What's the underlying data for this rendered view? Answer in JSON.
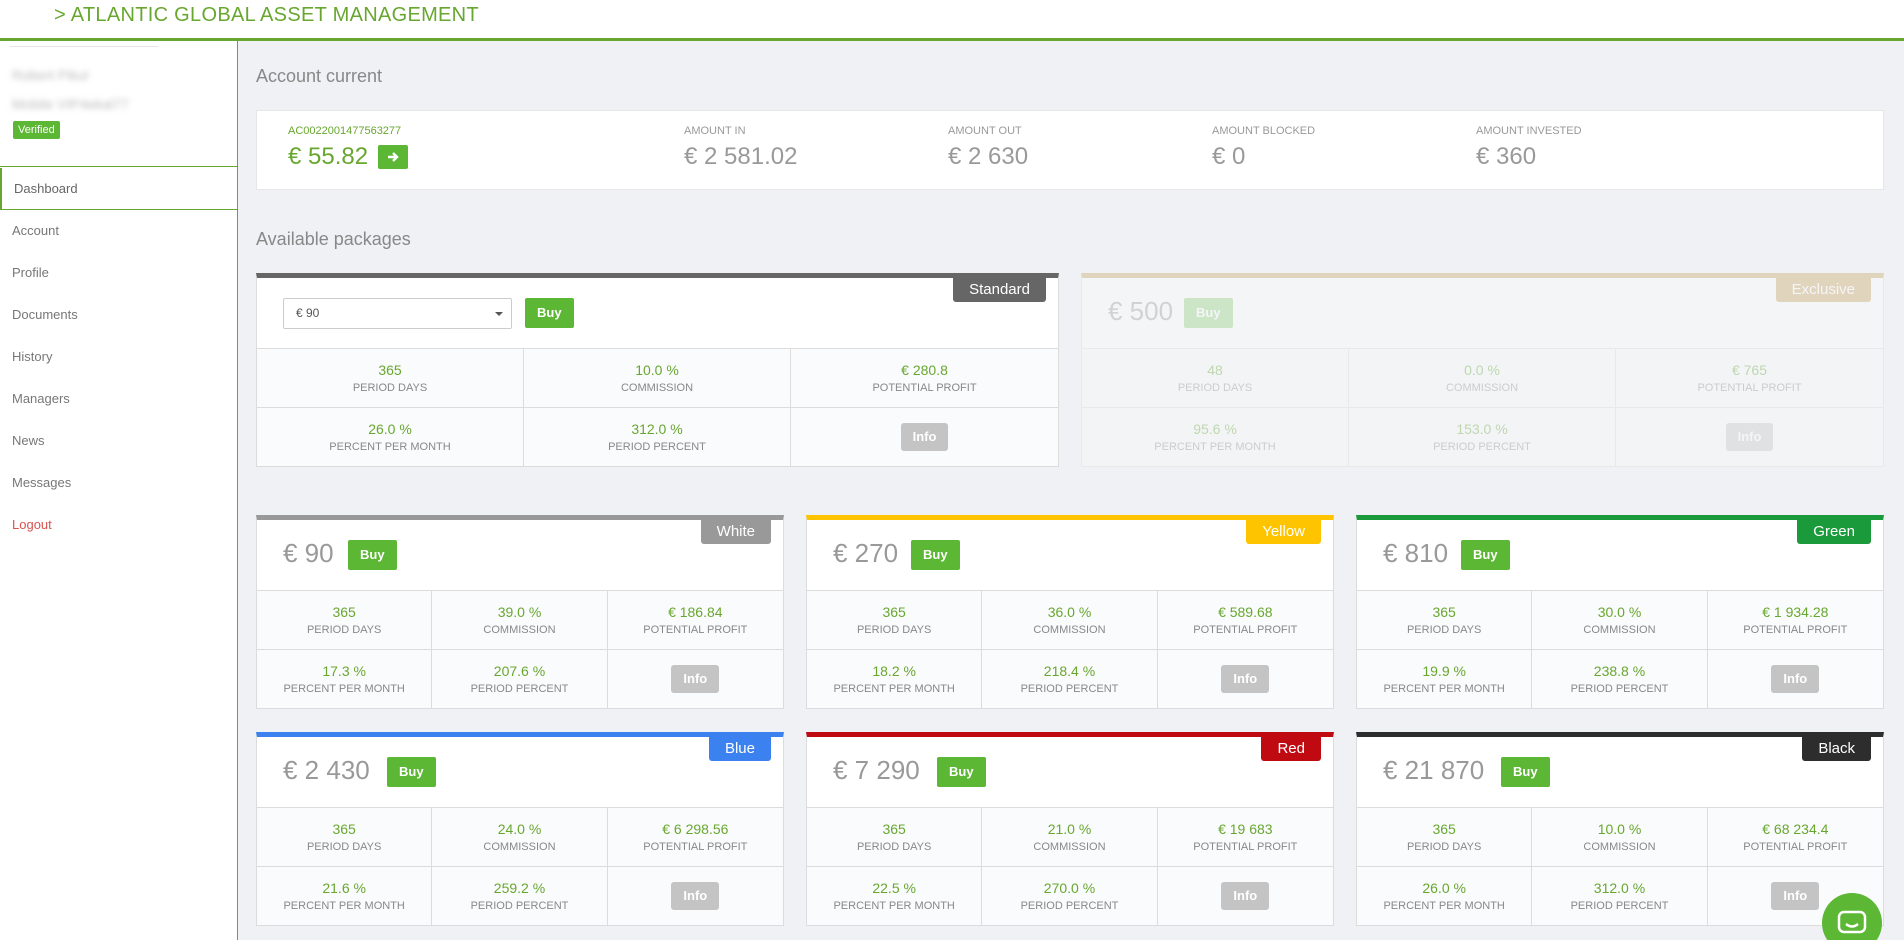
{
  "brand": "> ATLANTIC GLOBAL ASSET MANAGEMENT",
  "user": {
    "name": "Robert Pikul",
    "code": "Mobile VIP4ekal77",
    "status": "Verified"
  },
  "nav": [
    {
      "label": "Dashboard",
      "name": "dashboard"
    },
    {
      "label": "Account",
      "name": "account"
    },
    {
      "label": "Profile",
      "name": "profile"
    },
    {
      "label": "Documents",
      "name": "documents"
    },
    {
      "label": "History",
      "name": "history"
    },
    {
      "label": "Managers",
      "name": "managers"
    },
    {
      "label": "News",
      "name": "news"
    },
    {
      "label": "Messages",
      "name": "messages"
    },
    {
      "label": "Logout",
      "name": "logout"
    }
  ],
  "account": {
    "title": "Account current",
    "id": "AC0022001477563277",
    "balance": "€ 55.82",
    "amount_in_label": "AMOUNT IN",
    "amount_in": "€ 2 581.02",
    "amount_out_label": "AMOUNT OUT",
    "amount_out": "€ 2 630",
    "amount_blocked_label": "AMOUNT BLOCKED",
    "amount_blocked": "€ 0",
    "amount_invested_label": "AMOUNT INVESTED",
    "amount_invested": "€ 360"
  },
  "packages_title": "Available packages",
  "labels": {
    "period_days": "PERIOD DAYS",
    "commission": "COMMISSION",
    "potential_profit": "POTENTIAL PROFIT",
    "percent_per_month": "PERCENT PER MONTH",
    "period_percent": "PERIOD PERCENT",
    "buy": "Buy",
    "info": "Info"
  },
  "standard": {
    "badge": "Standard",
    "color": "#666666",
    "select_value": "€ 90",
    "days": "365",
    "commission": "10.0 %",
    "profit": "€ 280.8",
    "ppm": "26.0 %",
    "pp": "312.0 %"
  },
  "exclusive": {
    "badge": "Exclusive",
    "color": "#c8a05a",
    "price": "€ 500",
    "days": "48",
    "commission": "0.0 %",
    "profit": "€ 765",
    "ppm": "95.6 %",
    "pp": "153.0 %"
  },
  "packages": [
    {
      "key": "white",
      "badge": "White",
      "color": "#999999",
      "price": "€ 90",
      "days": "365",
      "commission": "39.0 %",
      "profit": "€ 186.84",
      "ppm": "17.3 %",
      "pp": "207.6 %"
    },
    {
      "key": "yellow",
      "badge": "Yellow",
      "color": "#ffc400",
      "price": "€ 270",
      "days": "365",
      "commission": "36.0 %",
      "profit": "€ 589.68",
      "ppm": "18.2 %",
      "pp": "218.4 %"
    },
    {
      "key": "green",
      "badge": "Green",
      "color": "#1a9a3a",
      "price": "€ 810",
      "days": "365",
      "commission": "30.0 %",
      "profit": "€ 1 934.28",
      "ppm": "19.9 %",
      "pp": "238.8 %"
    },
    {
      "key": "blue",
      "badge": "Blue",
      "color": "#3b82f0",
      "price": "€ 2 430",
      "days": "365",
      "commission": "24.0 %",
      "profit": "€ 6 298.56",
      "ppm": "21.6 %",
      "pp": "259.2 %"
    },
    {
      "key": "red",
      "badge": "Red",
      "color": "#c00a12",
      "price": "€ 7 290",
      "days": "365",
      "commission": "21.0 %",
      "profit": "€ 19 683",
      "ppm": "22.5 %",
      "pp": "270.0 %"
    },
    {
      "key": "black",
      "badge": "Black",
      "color": "#2d2d2d",
      "price": "€ 21 870",
      "days": "365",
      "commission": "10.0 %",
      "profit": "€ 68 234.4",
      "ppm": "26.0 %",
      "pp": "312.0 %"
    }
  ]
}
